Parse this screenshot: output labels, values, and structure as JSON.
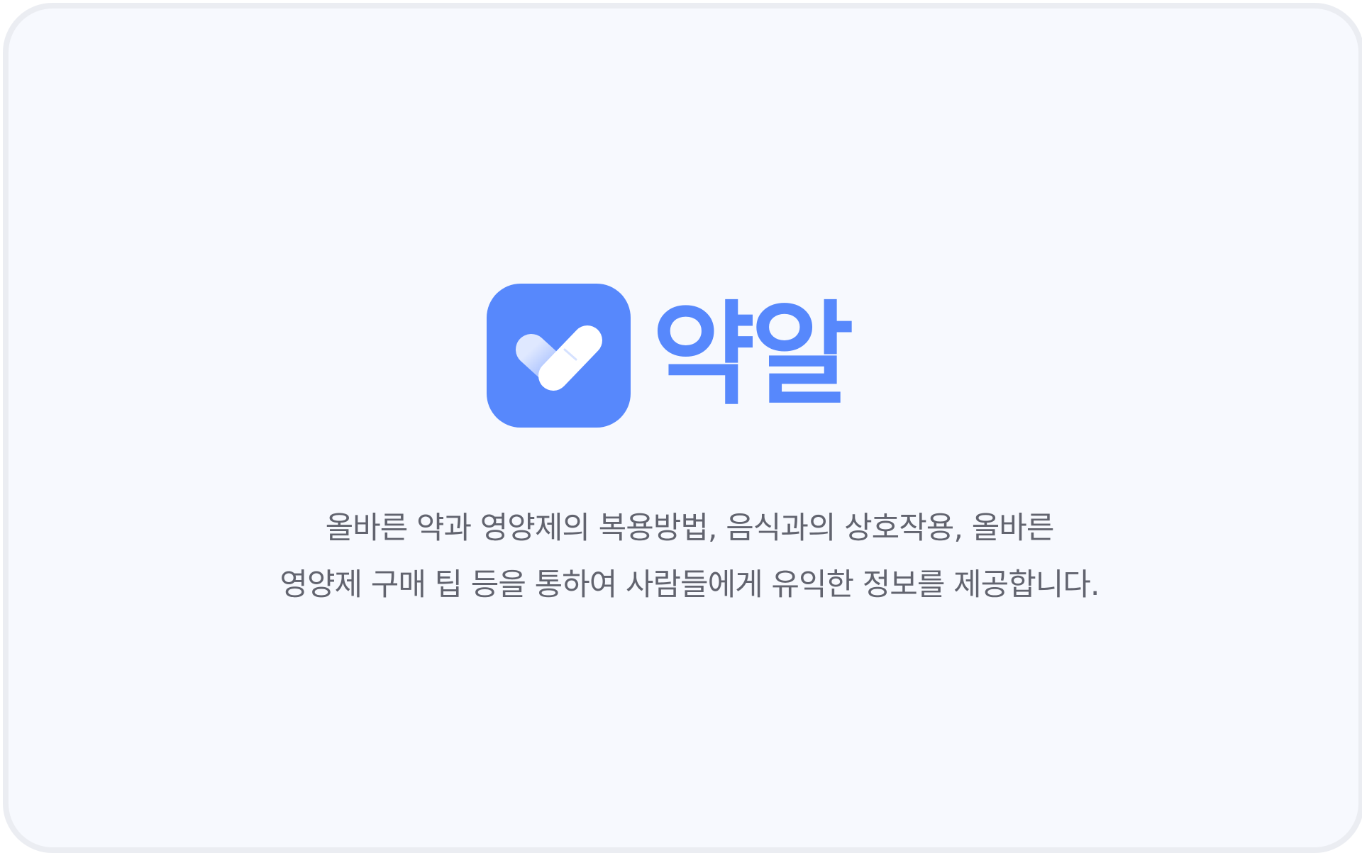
{
  "brand": {
    "name": "약알",
    "icon": "pill-check-icon",
    "color": "#5788fc"
  },
  "description": {
    "line1": "올바른 약과 영양제의 복용방법, 음식과의 상호작용, 올바른",
    "line2": "영양제 구매 팁 등을 통하여 사람들에게 유익한 정보를 제공합니다."
  },
  "colors": {
    "background": "#f7f9fe",
    "border": "#ebedf2",
    "text": "#62646f"
  }
}
